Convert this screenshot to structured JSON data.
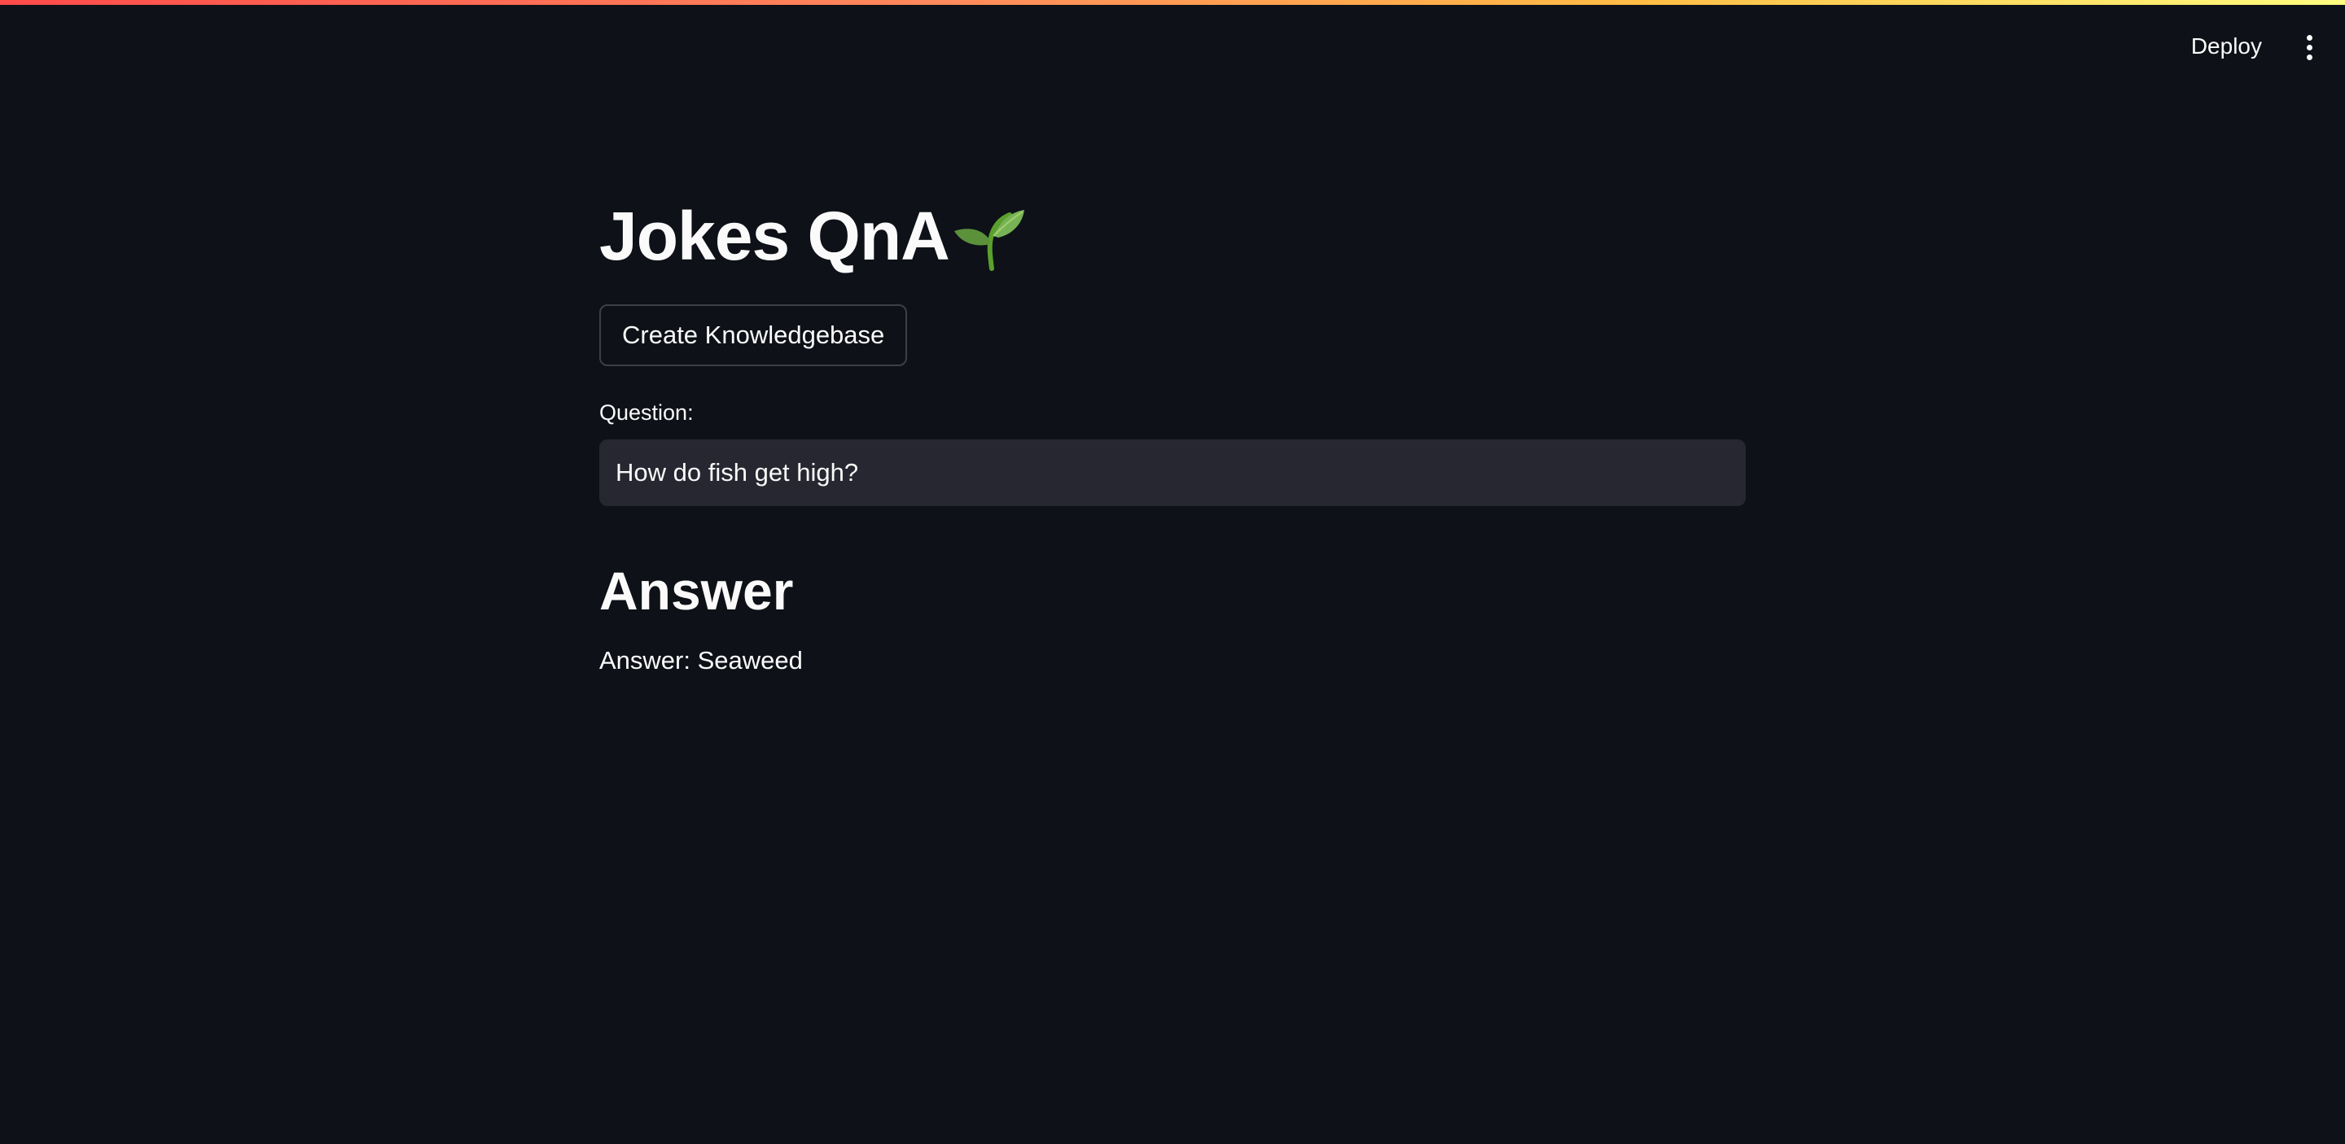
{
  "header": {
    "deploy_label": "Deploy",
    "menu_icon": "kebab-menu-icon"
  },
  "main": {
    "title": "Jokes QnA",
    "title_icon": "seedling-icon",
    "kb_button_label": "Create Knowledgebase",
    "question_label": "Question:",
    "question_value": "How do fish get high?",
    "answer_heading": "Answer",
    "answer_text": "Answer: Seaweed"
  },
  "colors": {
    "background": "#0e1117",
    "input_background": "#262730",
    "text": "#fafafa",
    "accent_gradient_start": "#ff4b4b",
    "accent_gradient_end": "#fffd80"
  }
}
